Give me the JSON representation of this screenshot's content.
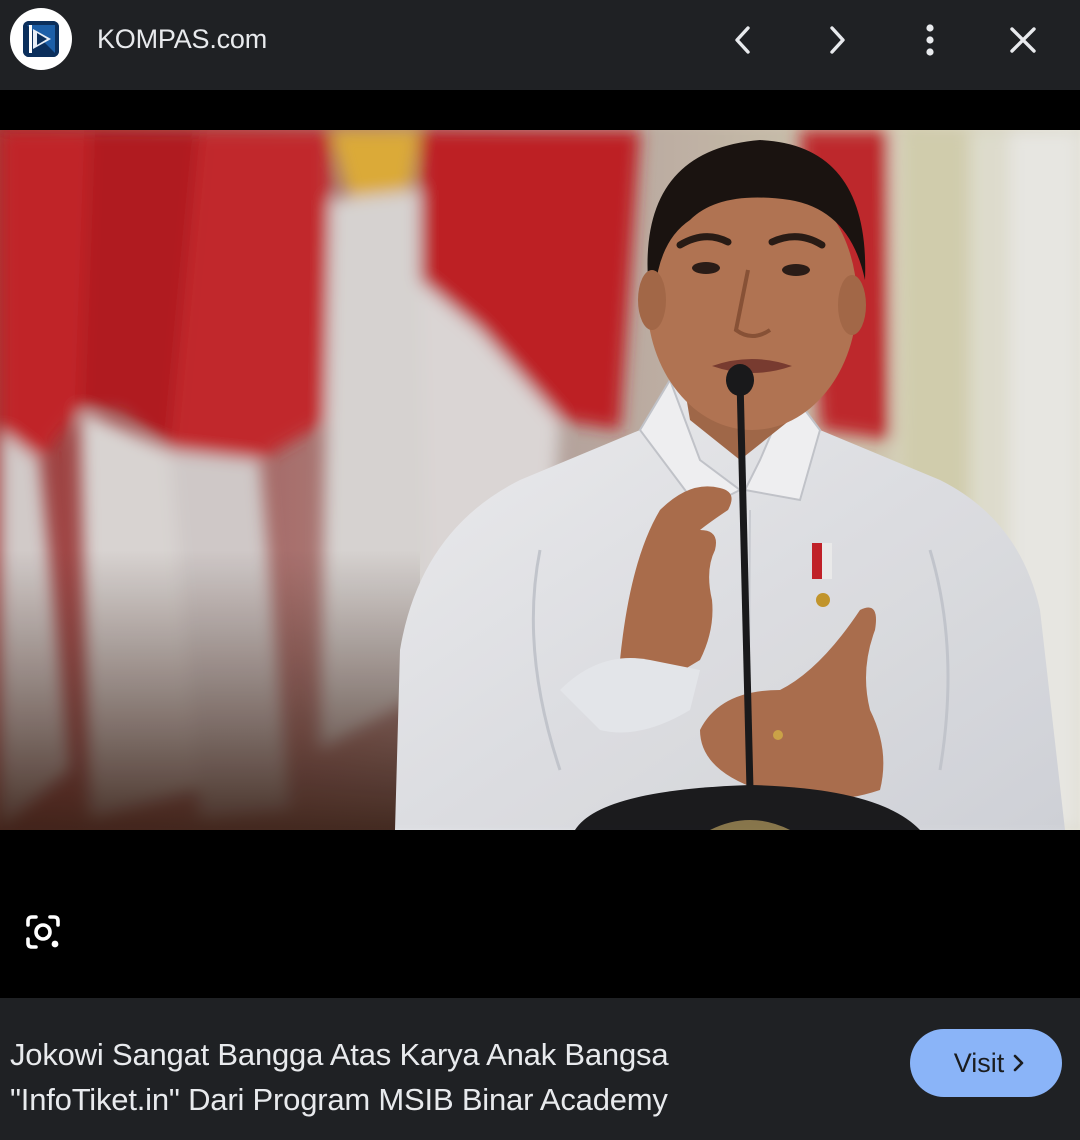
{
  "header": {
    "site_name": "KOMPAS.com",
    "logo_letter": "K",
    "icons": {
      "logo": "kompas-logo-icon",
      "back": "chevron-left-icon",
      "forward": "chevron-right-icon",
      "menu": "more-vert-icon",
      "close": "close-icon"
    }
  },
  "viewer": {
    "photo_subject": "man in white shirt speaking at microphone in front of red and white flags",
    "lens_icon": "lens-search-icon"
  },
  "card": {
    "headline_line1": "Jokowi Sangat Bangga Atas Karya Anak Bangsa",
    "headline_line2": "\"InfoTiket.in\" Dari Program MSIB Binar Academy",
    "visit_label": "Visit",
    "visit_icon": "chevron-right-icon"
  },
  "colors": {
    "bar_background": "#1f2124",
    "page_background": "#000000",
    "visit_button": "#8ab4f8",
    "text": "#e8eaed"
  }
}
